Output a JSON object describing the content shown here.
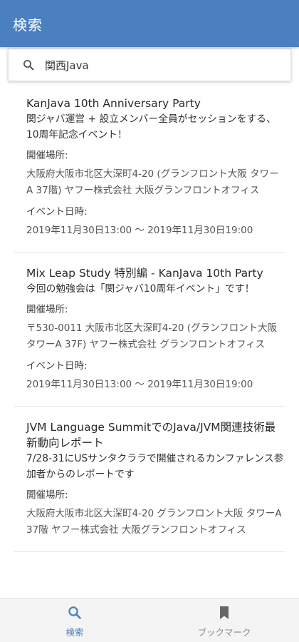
{
  "app_bar": {
    "title": "検索"
  },
  "search": {
    "value": "関西Java",
    "icon": "search-icon"
  },
  "results": [
    {
      "title": "KanJava 10th Anniversary Party",
      "description": "関ジャバ運営 + 設立メンバー全員がセッションをする、10周年記念イベント！",
      "venue_label": "開催場所:",
      "venue": "大阪府大阪市北区大深町4-20 (グランフロント大阪 タワーA 37階) ヤフー株式会社 大阪グランフロントオフィス",
      "date_label": "イベント日時:",
      "date": "2019年11月30日13:00 ～ 2019年11月30日19:00"
    },
    {
      "title": "Mix Leap Study 特別編 - KanJava 10th Party",
      "description": "今回の勉強会は「関ジャバ10周年イベント」です！",
      "venue_label": "開催場所:",
      "venue": "〒530-0011 大阪市北区大深町4-20 (グランフロント大阪タワーA 37F) ヤフー株式会社 グランフロントオフィス",
      "date_label": "イベント日時:",
      "date": "2019年11月30日13:00 ～ 2019年11月30日19:00"
    },
    {
      "title": "JVM Language SummitでのJava/JVM関連技術最新動向レポート",
      "description": "7/28-31にUSサンタクララで開催されるカンファレンス参加者からのレポートです",
      "venue_label": "開催場所:",
      "venue": "大阪府大阪市北区大深町4-20 グランフロント大阪 タワーA 37階 ヤフー株式会社 大阪グランフロントオフィス",
      "date_label": "",
      "date": ""
    }
  ],
  "bottom_nav": {
    "tabs": [
      {
        "label": "検索",
        "icon": "search-icon",
        "active": true
      },
      {
        "label": "ブックマーク",
        "icon": "bookmark-icon",
        "active": false
      }
    ]
  },
  "colors": {
    "primary": "#4a7fc0",
    "inactive": "#8a8a8a"
  }
}
